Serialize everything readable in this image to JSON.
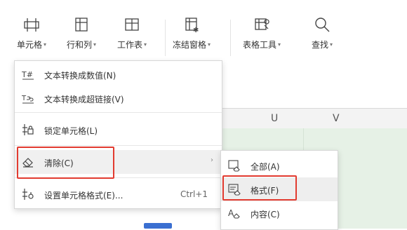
{
  "ribbon": {
    "buttons": [
      {
        "label": "单元格",
        "icon": "cell-icon"
      },
      {
        "label": "行和列",
        "icon": "row-col-icon"
      },
      {
        "label": "工作表",
        "icon": "sheet-icon"
      },
      {
        "label": "冻结窗格",
        "icon": "freeze-pane-icon"
      },
      {
        "label": "表格工具",
        "icon": "table-tools-icon"
      },
      {
        "label": "查找",
        "icon": "search-icon"
      }
    ],
    "caret": "▾"
  },
  "columns": [
    "U",
    "V"
  ],
  "menu": {
    "items": [
      {
        "label": "文本转换成数值(N)",
        "icon": "text-to-number-icon"
      },
      {
        "label": "文本转换成超链接(V)",
        "icon": "text-to-hyperlink-icon"
      },
      {
        "label": "锁定单元格(L)",
        "icon": "lock-cell-icon"
      },
      {
        "label": "清除(C)",
        "icon": "eraser-icon",
        "arrow": "›"
      },
      {
        "label": "设置单元格格式(E)...",
        "icon": "format-cells-icon",
        "shortcut": "Ctrl+1"
      }
    ]
  },
  "submenu": {
    "items": [
      {
        "label": "全部(A)",
        "icon": "clear-all-icon"
      },
      {
        "label": "格式(F)",
        "icon": "clear-format-icon"
      },
      {
        "label": "内容(C)",
        "icon": "clear-content-icon"
      }
    ]
  },
  "colors": {
    "highlight_border": "#e23b30",
    "grid_green": "#e6f1e6"
  }
}
